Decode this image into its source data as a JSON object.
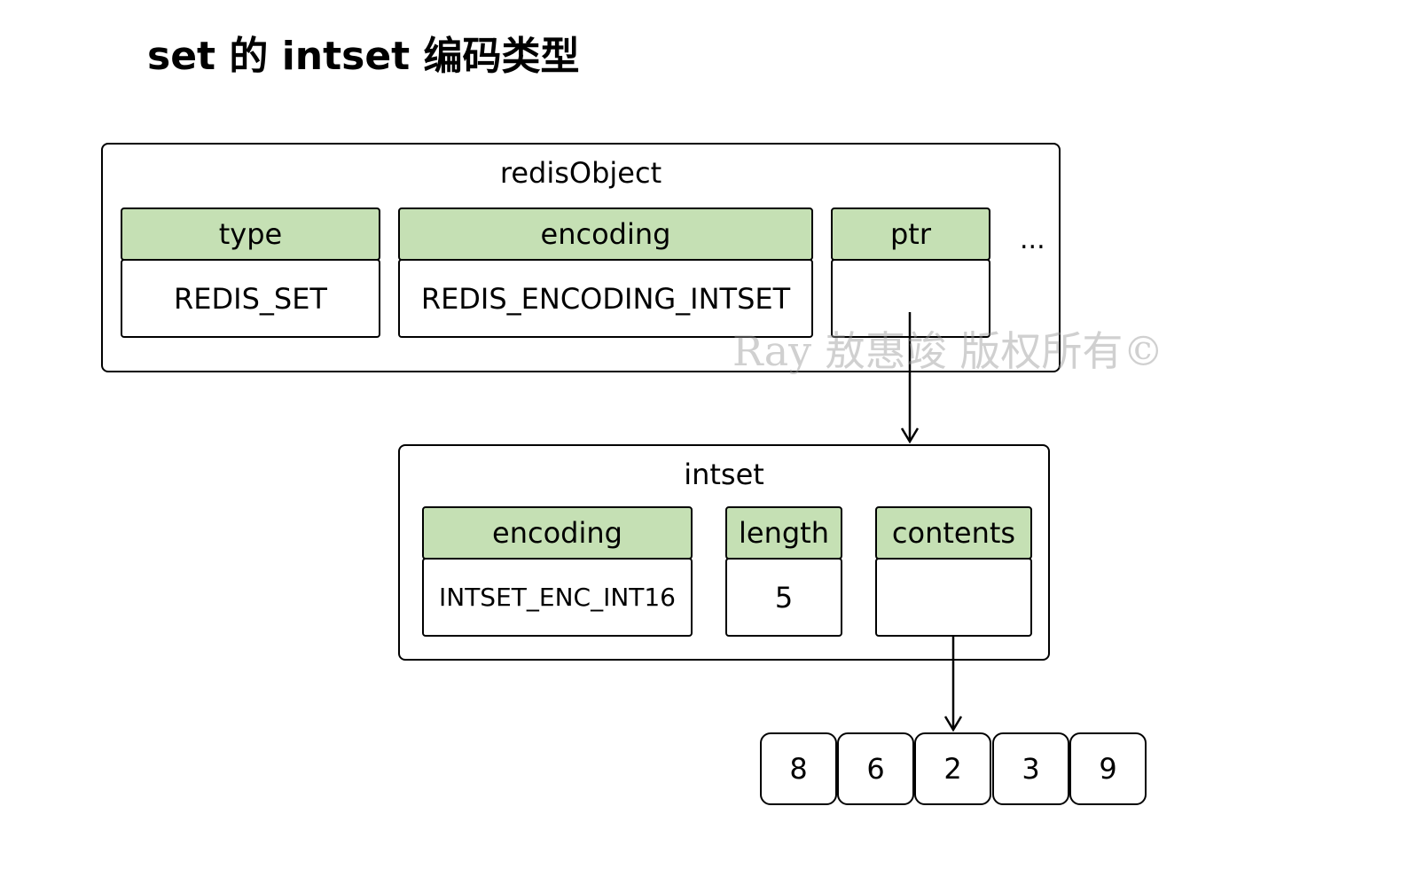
{
  "title": "set 的 intset 编码类型",
  "redis_object": {
    "label": "redisObject",
    "fields": [
      {
        "name": "type",
        "value": "REDIS_SET"
      },
      {
        "name": "encoding",
        "value": "REDIS_ENCODING_INTSET"
      },
      {
        "name": "ptr",
        "value": ""
      }
    ],
    "more": "..."
  },
  "intset": {
    "label": "intset",
    "fields": [
      {
        "name": "encoding",
        "value": "INTSET_ENC_INT16"
      },
      {
        "name": "length",
        "value": "5"
      },
      {
        "name": "contents",
        "value": ""
      }
    ]
  },
  "contents_array": [
    "8",
    "6",
    "2",
    "3",
    "9"
  ],
  "watermark": "Ray 敖惠竣 版权所有©"
}
